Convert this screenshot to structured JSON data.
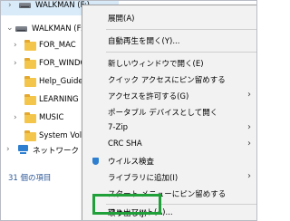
{
  "tree": {
    "top_drive": "WALKMAN (F:)",
    "drive": "WALKMAN (F:)",
    "folders": [
      "FOR_MAC",
      "FOR_WINDOWS",
      "Help_Guide",
      "LEARNING",
      "MUSIC",
      "System Volume Information"
    ],
    "network": "ネットワーク",
    "status": "31 個の項目"
  },
  "menu": {
    "items": {
      "expand": "展開(A)",
      "autoplay": "自動再生を開く(Y)...",
      "new_window": "新しいウィンドウで開く(E)",
      "pin_quick": "クイック アクセスにピン留めする",
      "grant_access": "アクセスを許可する(G)",
      "portable": "ポータブル デバイスとして開く",
      "zip": "7-Zip",
      "crc": "CRC SHA",
      "virus": "ウイルス検査",
      "library": "ライブラリに追加(I)",
      "pin_start": "スタート メニューにピン留めする",
      "format": "フォーマット(A)...",
      "eject": "取り出し(J)"
    }
  },
  "colors": {
    "highlight": "#1fa038",
    "selection": "#d9ebf9",
    "accent": "#2f7fd0"
  }
}
